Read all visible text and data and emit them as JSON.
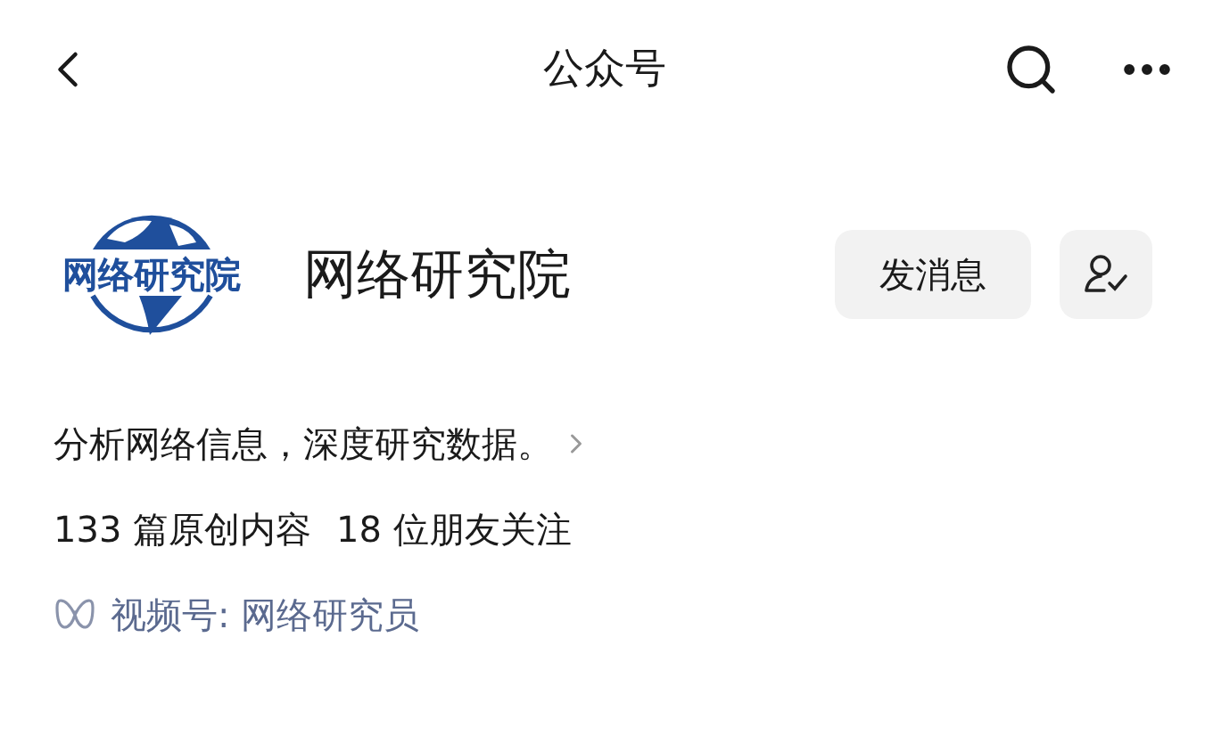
{
  "header": {
    "title": "公众号"
  },
  "account": {
    "logo_text": "网络研究院",
    "name": "网络研究院",
    "message_button": "发消息",
    "description": "分析网络信息，深度研究数据。",
    "stats": [
      "133 篇原创内容",
      "18 位朋友关注"
    ],
    "channel": "视频号: 网络研究员"
  }
}
